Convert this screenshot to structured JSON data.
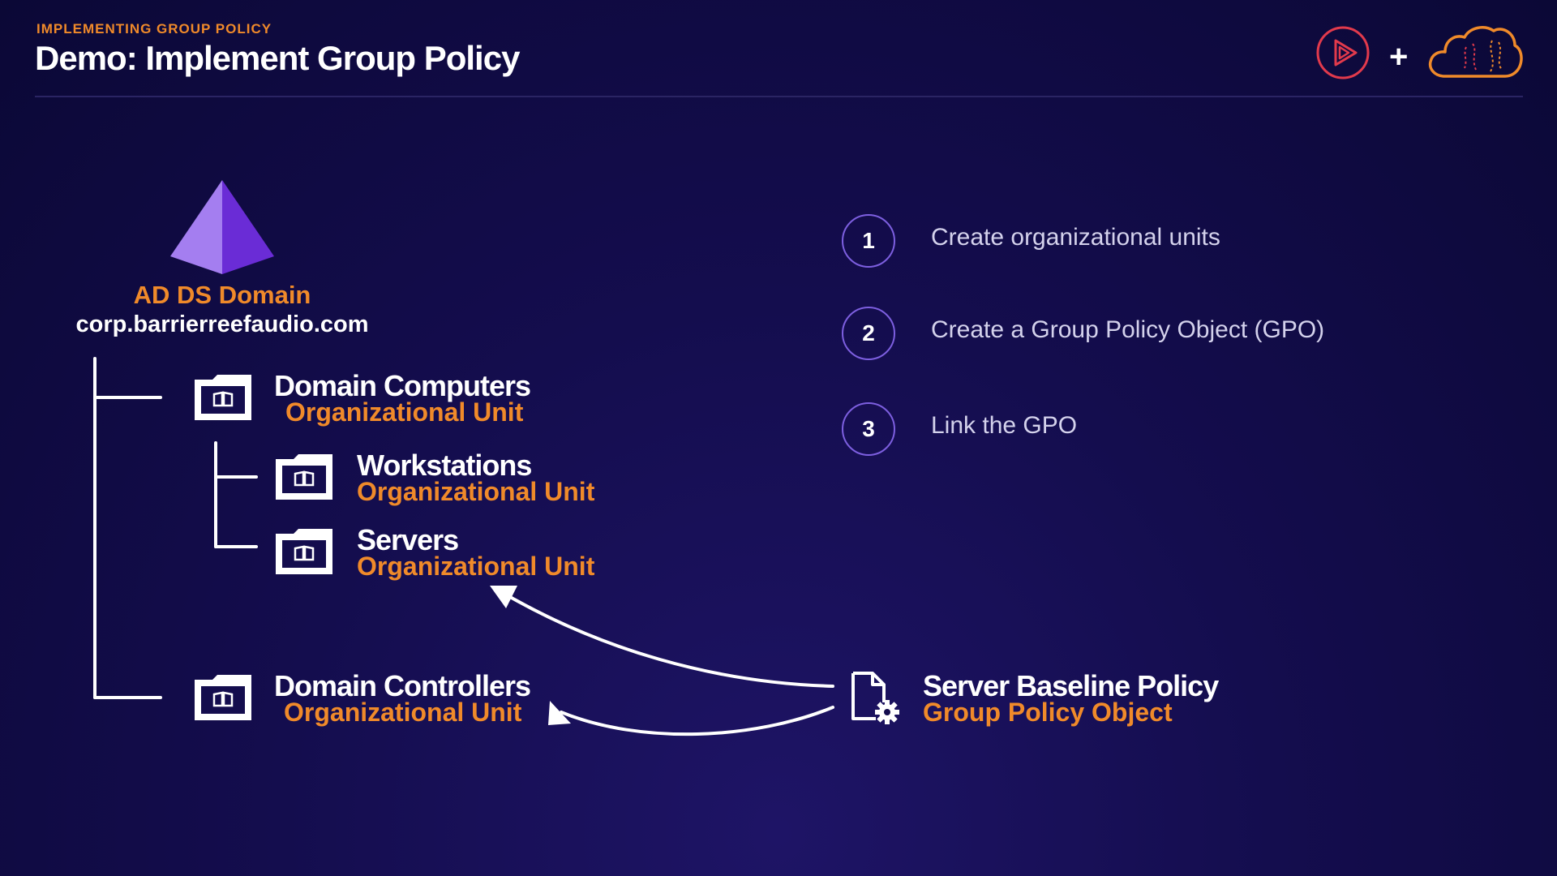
{
  "header": {
    "eyebrow": "IMPLEMENTING GROUP POLICY",
    "title": "Demo: Implement Group Policy",
    "plus": "+"
  },
  "colors": {
    "accent_orange": "#f08a2a",
    "circle_purple": "#7d5fe0",
    "background": "#140d4e",
    "logo_red": "#e23a4c"
  },
  "domain": {
    "label": "AD DS Domain",
    "name": "corp.barrierreefaudio.com",
    "icon": "pyramid-icon"
  },
  "ous": [
    {
      "name": "Domain Computers",
      "type": "Organizational Unit",
      "icon": "folder-icon"
    },
    {
      "name": "Workstations",
      "type": "Organizational Unit",
      "icon": "folder-icon"
    },
    {
      "name": "Servers",
      "type": "Organizational Unit",
      "icon": "folder-icon"
    },
    {
      "name": "Domain Controllers",
      "type": "Organizational Unit",
      "icon": "folder-icon"
    }
  ],
  "steps": [
    {
      "num": "1",
      "text": "Create organizational units"
    },
    {
      "num": "2",
      "text": "Create a Group Policy Object (GPO)"
    },
    {
      "num": "3",
      "text": "Link the GPO"
    }
  ],
  "gpo": {
    "name": "Server Baseline Policy",
    "type": "Group Policy Object",
    "icon": "document-gear-icon"
  }
}
